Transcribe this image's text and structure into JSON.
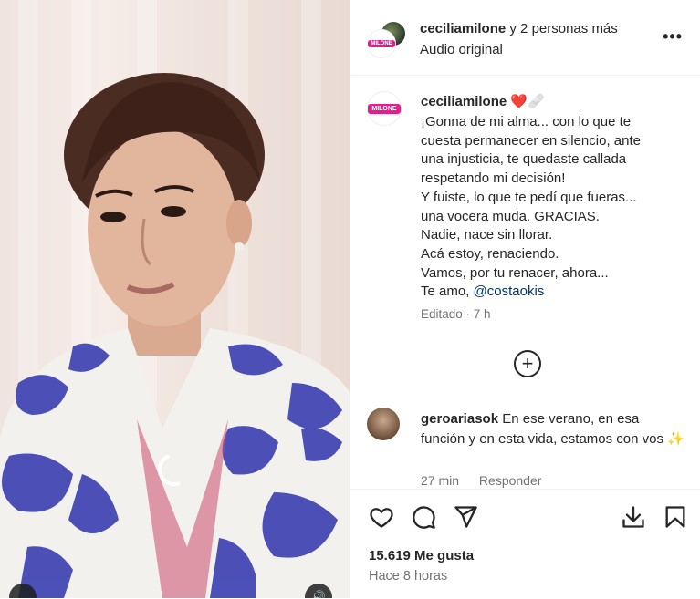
{
  "header": {
    "username": "ceciliamilone",
    "others": " y 2 personas más",
    "audio": "Audio original",
    "more_icon": "more-horizontal-icon"
  },
  "brand": {
    "logo_text": "MILONE",
    "accent": "#e21e8b"
  },
  "caption": {
    "username": "ceciliamilone",
    "emojis": " ❤️🩹",
    "lines": [
      "¡Gonna de mi alma... con lo que te",
      "cuesta permanecer en silencio, ante",
      "una injusticia, te quedaste callada",
      "respetando mi decisión!",
      "Y fuiste, lo que te pedí que fueras...",
      "una vocera muda. GRACIAS.",
      "Nadie, nace sin llorar.",
      "Acá estoy, renaciendo.",
      "Vamos, por tu renacer, ahora...",
      "Te amo, "
    ],
    "mention": "@costaokis",
    "meta": "Editado · 7 h"
  },
  "comment": {
    "username": "geroariasok",
    "text": " En ese verano, en esa función y en esta vida, estamos con vos ✨",
    "time": "27 min",
    "reply": "Responder"
  },
  "actions": {
    "likes": "15.619 Me gusta",
    "time": "Hace 8 horas"
  }
}
